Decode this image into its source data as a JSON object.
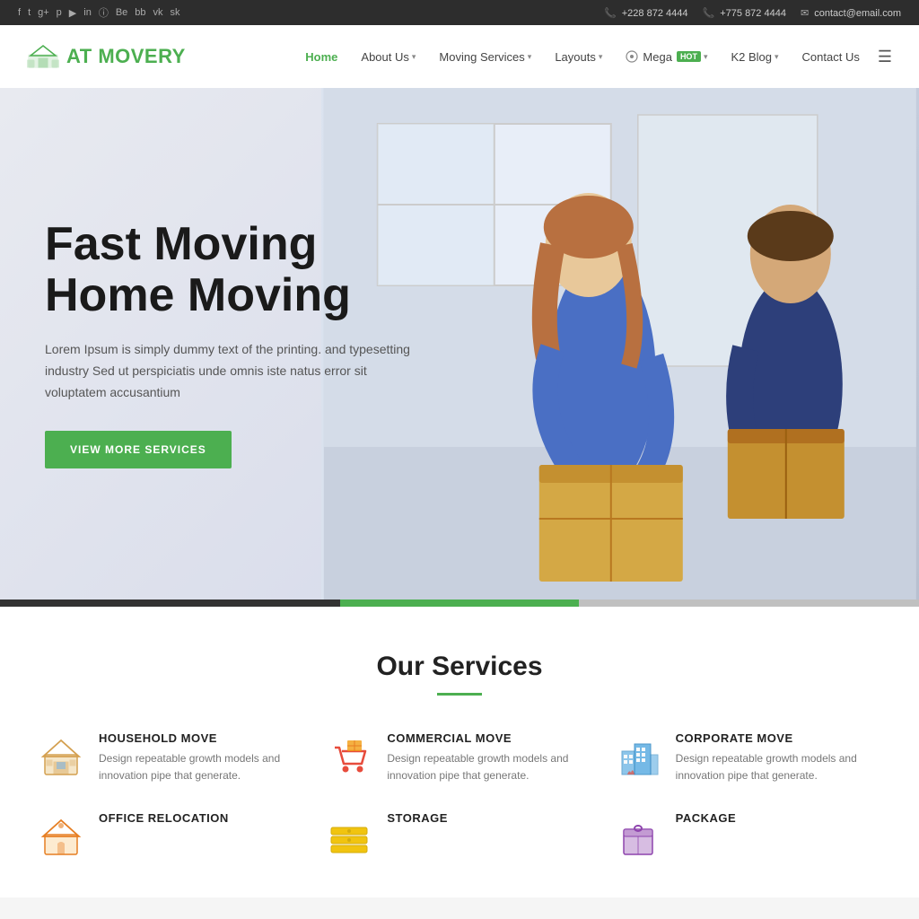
{
  "topbar": {
    "social_icons": [
      "f",
      "t",
      "g+",
      "p",
      "yt",
      "in",
      "ins",
      "be",
      "bb",
      "vk",
      "sk"
    ],
    "phone1": "+228 872 4444",
    "phone2": "+775 872 4444",
    "email": "contact@email.com"
  },
  "header": {
    "logo_text_pre": "AT ",
    "logo_text_accent": "MOVERY",
    "nav_items": [
      {
        "label": "Home",
        "active": true,
        "has_dropdown": false
      },
      {
        "label": "About Us",
        "active": false,
        "has_dropdown": true
      },
      {
        "label": "Moving Services",
        "active": false,
        "has_dropdown": true
      },
      {
        "label": "Layouts",
        "active": false,
        "has_dropdown": true
      },
      {
        "label": "Mega",
        "active": false,
        "has_dropdown": true,
        "badge": "HOT"
      },
      {
        "label": "K2 Blog",
        "active": false,
        "has_dropdown": true
      },
      {
        "label": "Contact Us",
        "active": false,
        "has_dropdown": false
      }
    ]
  },
  "hero": {
    "title_line1": "Fast Moving",
    "title_line2": "Home Moving",
    "description": "Lorem Ipsum is simply dummy text of the printing. and typesetting industry Sed ut perspiciatis unde omnis iste natus error sit voluptatem accusantium",
    "button_label": "VIEW MORE SERVICES"
  },
  "services": {
    "section_title": "Our Services",
    "items": [
      {
        "id": "household",
        "title": "HOUSEHOLD MOVE",
        "description": "Design repeatable growth models and innovation pipe that generate.",
        "icon_color": "#e67e22"
      },
      {
        "id": "commercial",
        "title": "COMMERCIAL MOVE",
        "description": "Design repeatable growth models and innovation pipe that generate.",
        "icon_color": "#e74c3c"
      },
      {
        "id": "corporate",
        "title": "CORPORATE MOVE",
        "description": "Design repeatable growth models and innovation pipe that generate.",
        "icon_color": "#3498db"
      },
      {
        "id": "office",
        "title": "OFFICE RELOCATION",
        "description": "",
        "icon_color": "#e67e22"
      },
      {
        "id": "storage",
        "title": "STORAGE",
        "description": "",
        "icon_color": "#f1c40f"
      },
      {
        "id": "package",
        "title": "PACKAGE",
        "description": "",
        "icon_color": "#9b59b6"
      }
    ]
  }
}
